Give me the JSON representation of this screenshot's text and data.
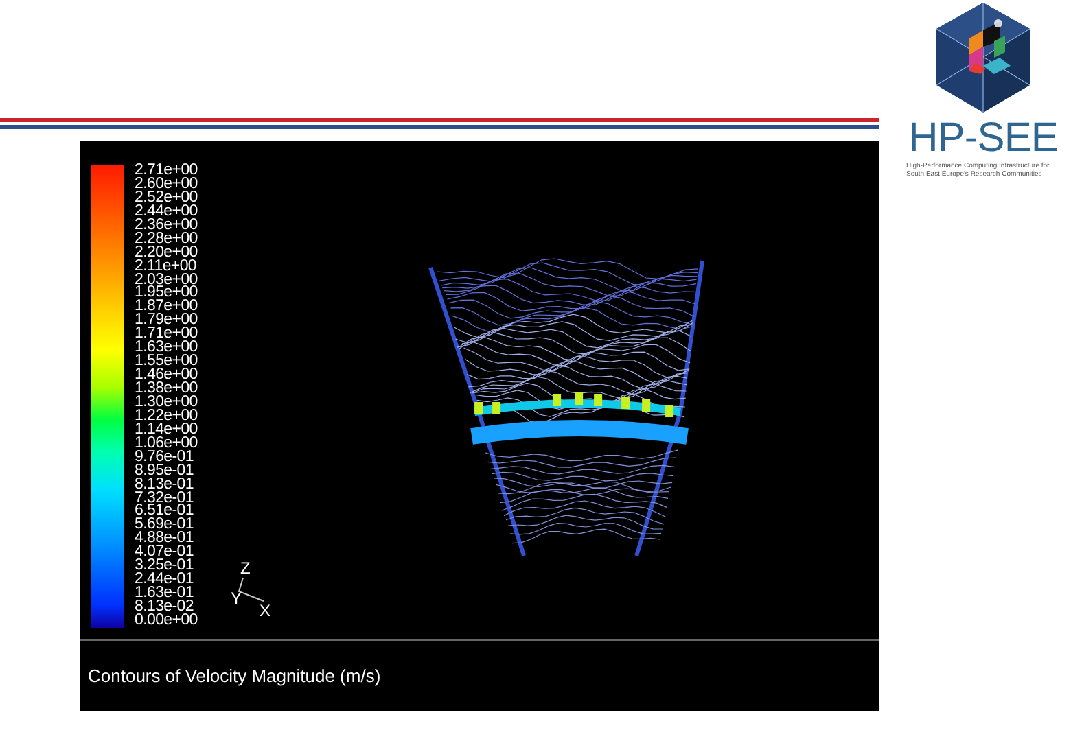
{
  "logo": {
    "name": "HP-SEE",
    "tagline": "High-Performance Computing Infrastructure for South East Europe's Research Communities"
  },
  "graphics_window": {
    "legend": {
      "labels": [
        "2.71e+00",
        "2.60e+00",
        "2.52e+00",
        "2.44e+00",
        "2.36e+00",
        "2.28e+00",
        "2.20e+00",
        "2.11e+00",
        "2.03e+00",
        "1.95e+00",
        "1.87e+00",
        "1.79e+00",
        "1.71e+00",
        "1.63e+00",
        "1.55e+00",
        "1.46e+00",
        "1.38e+00",
        "1.30e+00",
        "1.22e+00",
        "1.14e+00",
        "1.06e+00",
        "9.76e-01",
        "8.95e-01",
        "8.13e-01",
        "7.32e-01",
        "6.51e-01",
        "5.69e-01",
        "4.88e-01",
        "4.07e-01",
        "3.25e-01",
        "2.44e-01",
        "1.63e-01",
        "8.13e-02",
        "0.00e+00"
      ]
    },
    "triad": {
      "z": "Z",
      "y": "Y",
      "x": "X"
    },
    "caption": "Contours of Velocity Magnitude (m/s)"
  }
}
